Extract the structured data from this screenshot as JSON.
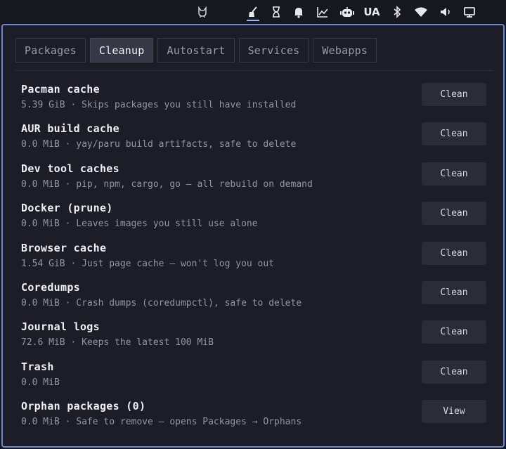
{
  "topbar": {
    "icons": [
      "app-launcher-icon",
      "broom-icon",
      "hourglass-icon",
      "bell-icon",
      "activity-chart-icon",
      "robot-icon",
      "keyboard-layout",
      "bluetooth-icon",
      "wifi-icon",
      "volume-icon",
      "monitor-icon"
    ],
    "keyboard_layout": "UA",
    "accent": "#9fb6ff"
  },
  "tabs": [
    {
      "label": "Packages",
      "active": false
    },
    {
      "label": "Cleanup",
      "active": true
    },
    {
      "label": "Autostart",
      "active": false
    },
    {
      "label": "Services",
      "active": false
    },
    {
      "label": "Webapps",
      "active": false
    }
  ],
  "items": [
    {
      "title": "Pacman cache",
      "desc": "5.39 GiB · Skips packages you still have installed",
      "button": "Clean"
    },
    {
      "title": "AUR build cache",
      "desc": "0.0 MiB · yay/paru build artifacts, safe to delete",
      "button": "Clean"
    },
    {
      "title": "Dev tool caches",
      "desc": "0.0 MiB · pip, npm, cargo, go — all rebuild on demand",
      "button": "Clean"
    },
    {
      "title": "Docker (prune)",
      "desc": "0.0 MiB · Leaves images you still use alone",
      "button": "Clean"
    },
    {
      "title": "Browser cache",
      "desc": "1.54 GiB · Just page cache — won't log you out",
      "button": "Clean"
    },
    {
      "title": "Coredumps",
      "desc": "0.0 MiB · Crash dumps (coredumpctl), safe to delete",
      "button": "Clean"
    },
    {
      "title": "Journal logs",
      "desc": "72.6 MiB · Keeps the latest 100 MiB",
      "button": "Clean"
    },
    {
      "title": "Trash",
      "desc": "0.0 MiB",
      "button": "Clean"
    },
    {
      "title": "Orphan packages (0)",
      "desc": "0.0 MiB · Safe to remove — opens Packages → Orphans",
      "button": "View"
    }
  ],
  "colors": {
    "panel_border": "#6a86d6",
    "background": "#17181f",
    "panel_bg": "#1c1d27",
    "button_bg": "#2a2c38"
  }
}
